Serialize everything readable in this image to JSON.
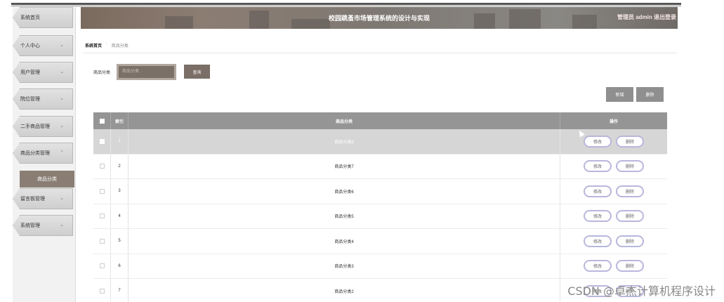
{
  "header": {
    "title": "校园跳蚤市场管理系统的设计与实现",
    "user_text": "管理员 admin  退出登录"
  },
  "sidebar": {
    "items": [
      {
        "label": "系统首页",
        "icon": ""
      },
      {
        "label": "个人中心",
        "icon": "chevron-down"
      },
      {
        "label": "用户管理",
        "icon": "chevron-down"
      },
      {
        "label": "院位管理",
        "icon": "chevron-down"
      },
      {
        "label": "二手商品管理",
        "icon": "chevron-down"
      },
      {
        "label": "商品分类管理",
        "icon": "chevron-up"
      },
      {
        "label": "留言板管理",
        "icon": "chevron-down"
      },
      {
        "label": "系统管理",
        "icon": "chevron-down"
      }
    ],
    "submenu_active": "商品分类"
  },
  "breadcrumb": {
    "home": "系统首页",
    "separator": ":",
    "current": "商品分类"
  },
  "search": {
    "label": "商品分类",
    "placeholder": "商品分类",
    "query_button": "查询"
  },
  "actions": {
    "add": "新增",
    "delete": "删除"
  },
  "table": {
    "headers": {
      "index": "索引",
      "name": "商品分类",
      "op": "操作"
    },
    "rows": [
      {
        "index": "1",
        "name": "商品分类8",
        "edit": "修改",
        "del": "删除"
      },
      {
        "index": "2",
        "name": "商品分类7",
        "edit": "修改",
        "del": "删除"
      },
      {
        "index": "3",
        "name": "商品分类6",
        "edit": "修改",
        "del": "删除"
      },
      {
        "index": "4",
        "name": "商品分类5",
        "edit": "修改",
        "del": "删除"
      },
      {
        "index": "5",
        "name": "商品分类4",
        "edit": "修改",
        "del": "删除"
      },
      {
        "index": "6",
        "name": "商品分类3",
        "edit": "修改",
        "del": "删除"
      },
      {
        "index": "7",
        "name": "商品分类2",
        "edit": "修改",
        "del": "删除"
      }
    ]
  },
  "watermark": "CSDN @卓杰计算机程序设计"
}
